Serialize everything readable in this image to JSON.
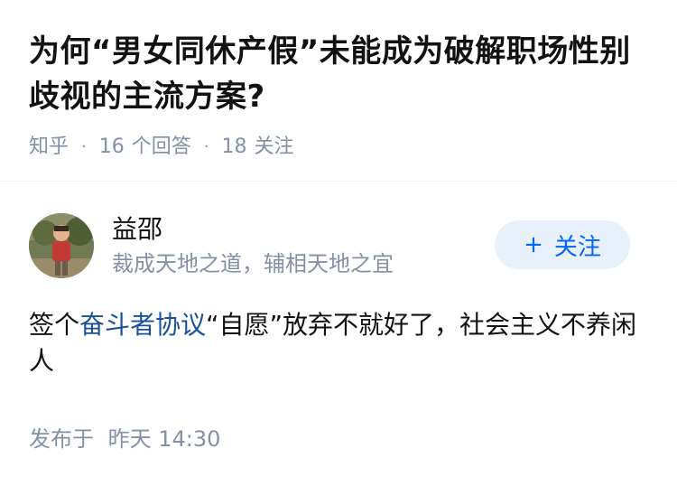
{
  "question": {
    "title": "为何“男女同休产假”未能成为破解职场性别歧视的主流方案?",
    "source": "知乎",
    "answers_count": "16",
    "answers_label": "个回答",
    "followers_count": "18",
    "followers_label": "关注"
  },
  "author": {
    "name": "益邵",
    "bio": "裁成天地之道，辅相天地之宜",
    "follow_plus": "+",
    "follow_label": "关注"
  },
  "answer": {
    "text_before": "签个",
    "link_text": "奋斗者协议",
    "text_after": "“自愿”放弃不就好了，社会主义不养闲人",
    "published_label": "发布于",
    "published_time": "昨天 14:30"
  },
  "colors": {
    "accent": "#0066ff",
    "link": "#175199",
    "meta": "#8590a6",
    "follow_bg": "#e8f0fa"
  }
}
